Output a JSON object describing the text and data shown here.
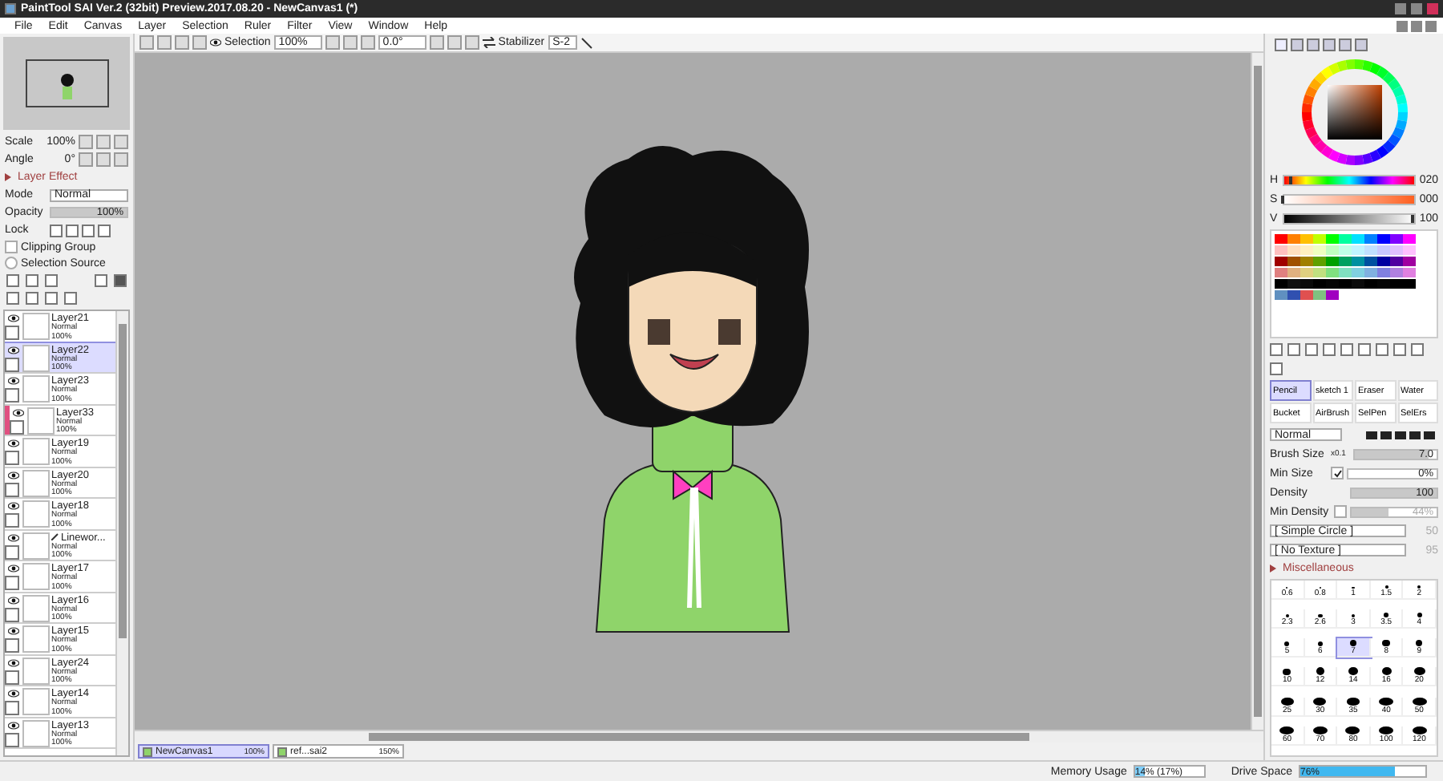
{
  "window": {
    "title": "PaintTool SAI Ver.2 (32bit) Preview.2017.08.20 - NewCanvas1 (*)"
  },
  "menu": [
    "File",
    "Edit",
    "Canvas",
    "Layer",
    "Selection",
    "Ruler",
    "Filter",
    "View",
    "Window",
    "Help"
  ],
  "toolbar": {
    "selection_label": "Selection",
    "zoom": "100%",
    "angle": "0.0°",
    "stabilizer_label": "Stabilizer",
    "stabilizer": "S-2"
  },
  "navigator": {
    "scale_label": "Scale",
    "scale": "100%",
    "angle_label": "Angle",
    "angle": "0°"
  },
  "layer_effect": {
    "title": "Layer Effect",
    "mode_label": "Mode",
    "mode": "Normal",
    "opacity_label": "Opacity",
    "opacity": "100%",
    "level": 1,
    "lock_label": "Lock"
  },
  "layer_options": [
    {
      "kind": "checkbox",
      "label": "Clipping Group",
      "checked": false
    },
    {
      "kind": "radio",
      "label": "Selection Source",
      "checked": false
    }
  ],
  "layers": [
    {
      "name": "Layer21",
      "mode": "Normal",
      "opacity": "100%",
      "selected": false,
      "clipping": false,
      "kind": "plain"
    },
    {
      "name": "Layer22",
      "mode": "Normal",
      "opacity": "100%",
      "selected": true,
      "clipping": false,
      "kind": "plain"
    },
    {
      "name": "Layer23",
      "mode": "Normal",
      "opacity": "100%",
      "selected": false,
      "clipping": false,
      "kind": "plain"
    },
    {
      "name": "Layer33",
      "mode": "Normal",
      "opacity": "100%",
      "selected": false,
      "clipping": true,
      "kind": "plain"
    },
    {
      "name": "Layer19",
      "mode": "Normal",
      "opacity": "100%",
      "selected": false,
      "clipping": false,
      "kind": "plain"
    },
    {
      "name": "Layer20",
      "mode": "Normal",
      "opacity": "100%",
      "selected": false,
      "clipping": false,
      "kind": "plain"
    },
    {
      "name": "Layer18",
      "mode": "Normal",
      "opacity": "100%",
      "selected": false,
      "clipping": false,
      "kind": "plain"
    },
    {
      "name": "Linewor...",
      "mode": "Normal",
      "opacity": "100%",
      "selected": false,
      "clipping": false,
      "kind": "linework"
    },
    {
      "name": "Layer17",
      "mode": "Normal",
      "opacity": "100%",
      "selected": false,
      "clipping": false,
      "kind": "plain"
    },
    {
      "name": "Layer16",
      "mode": "Normal",
      "opacity": "100%",
      "selected": false,
      "clipping": false,
      "kind": "plain"
    },
    {
      "name": "Layer15",
      "mode": "Normal",
      "opacity": "100%",
      "selected": false,
      "clipping": false,
      "kind": "plain"
    },
    {
      "name": "Layer24",
      "mode": "Normal",
      "opacity": "100%",
      "selected": false,
      "clipping": false,
      "kind": "plain"
    },
    {
      "name": "Layer14",
      "mode": "Normal",
      "opacity": "100%",
      "selected": false,
      "clipping": false,
      "kind": "plain"
    },
    {
      "name": "Layer13",
      "mode": "Normal",
      "opacity": "100%",
      "selected": false,
      "clipping": false,
      "kind": "plain"
    }
  ],
  "canvas_tabs": [
    {
      "name": "NewCanvas1",
      "zoom": "100%",
      "selected": true
    },
    {
      "name": "ref...sai2",
      "zoom": "150%",
      "selected": false
    }
  ],
  "hsv": [
    {
      "label": "H",
      "value": "020",
      "level": 0.06
    },
    {
      "label": "S",
      "value": "000",
      "level": 0
    },
    {
      "label": "V",
      "value": "100",
      "level": 1
    }
  ],
  "swatch_rows": [
    [
      {
        "color": "#ff0000"
      },
      {
        "color": "#ff8000"
      },
      {
        "color": "#ffc000"
      },
      {
        "color": "#c0ff00"
      },
      {
        "color": "#00ff00"
      },
      {
        "color": "#00ffa0"
      },
      {
        "color": "#00e0ff"
      },
      {
        "color": "#0080ff"
      },
      {
        "color": "#0000ff"
      },
      {
        "color": "#8000ff"
      },
      {
        "color": "#ff00ff"
      }
    ],
    [
      {
        "color": "#ffc0c0"
      },
      {
        "color": "#ffe0c0"
      },
      {
        "color": "#fff0c0"
      },
      {
        "color": "#f0ffc0"
      },
      {
        "color": "#c0ffc0"
      },
      {
        "color": "#c0ffe8"
      },
      {
        "color": "#c0f4ff"
      },
      {
        "color": "#c0e0ff"
      },
      {
        "color": "#c8c8ff"
      },
      {
        "color": "#e0c0ff"
      },
      {
        "color": "#ffc0ff"
      }
    ],
    [
      {
        "color": "#a00000"
      },
      {
        "color": "#a05000"
      },
      {
        "color": "#a08000"
      },
      {
        "color": "#60a000"
      },
      {
        "color": "#00a000"
      },
      {
        "color": "#00a060"
      },
      {
        "color": "#0090a0"
      },
      {
        "color": "#0050a0"
      },
      {
        "color": "#0000a0"
      },
      {
        "color": "#5000a0"
      },
      {
        "color": "#a000a0"
      }
    ],
    [
      {
        "color": "#e08080"
      },
      {
        "color": "#e0b080"
      },
      {
        "color": "#e0d080"
      },
      {
        "color": "#c0e080"
      },
      {
        "color": "#80e080"
      },
      {
        "color": "#80e0c0"
      },
      {
        "color": "#80d0e0"
      },
      {
        "color": "#80b0e0"
      },
      {
        "color": "#8080e0"
      },
      {
        "color": "#b080e0"
      },
      {
        "color": "#e080e0"
      }
    ],
    [
      {
        "color": "#000000"
      },
      {
        "color": "#101010"
      },
      {
        "color": "#0a0a0a"
      },
      {
        "color": "#000000"
      },
      {
        "color": "#050505"
      },
      {
        "color": "#000000"
      },
      {
        "color": "#0a0a0a"
      },
      {
        "color": "#000000"
      },
      {
        "color": "#050505"
      },
      {
        "color": "#000000"
      },
      {
        "color": "#000000"
      }
    ],
    [
      {
        "color": "#6090c0"
      },
      {
        "color": "#3050b0"
      },
      {
        "color": "#e05050"
      },
      {
        "color": "#80c080"
      },
      {
        "color": "#a000c0"
      }
    ]
  ],
  "brush_tools": [
    {
      "label": "Pencil",
      "selected": true
    },
    {
      "label": "sketch 1",
      "selected": false
    },
    {
      "label": "Eraser",
      "selected": false
    },
    {
      "label": "Water",
      "selected": false
    },
    {
      "label": "Bucket",
      "selected": false
    },
    {
      "label": "AirBrush",
      "selected": false
    },
    {
      "label": "SelPen",
      "selected": false
    },
    {
      "label": "SelErs",
      "selected": false
    }
  ],
  "brush": {
    "blend": "Normal",
    "size": {
      "label": "Brush Size",
      "multiplier": "x0.1",
      "value": "7.0",
      "level": 0.9
    },
    "min_size": {
      "label": "Min Size",
      "checked": true,
      "value": "0%"
    },
    "density": {
      "label": "Density",
      "value": "100",
      "level": 1
    },
    "min_density": {
      "label": "Min Density",
      "checked": false,
      "value": "44%",
      "level": 0.44
    },
    "shape": "[ Simple Circle ]",
    "shape_value": "50",
    "texture": "[ No Texture ]",
    "texture_value": "95",
    "misc_label": "Miscellaneous"
  },
  "brush_sizes": [
    {
      "label": "0.6",
      "selected": false
    },
    {
      "label": "0.8",
      "selected": false
    },
    {
      "label": "1",
      "selected": false
    },
    {
      "label": "1.5",
      "selected": false
    },
    {
      "label": "2",
      "selected": false
    },
    {
      "label": "2.3",
      "selected": false
    },
    {
      "label": "2.6",
      "selected": false
    },
    {
      "label": "3",
      "selected": false
    },
    {
      "label": "3.5",
      "selected": false
    },
    {
      "label": "4",
      "selected": false
    },
    {
      "label": "5",
      "selected": false
    },
    {
      "label": "6",
      "selected": false
    },
    {
      "label": "7",
      "selected": true
    },
    {
      "label": "8",
      "selected": false
    },
    {
      "label": "9",
      "selected": false
    },
    {
      "label": "10",
      "selected": false
    },
    {
      "label": "12",
      "selected": false
    },
    {
      "label": "14",
      "selected": false
    },
    {
      "label": "16",
      "selected": false
    },
    {
      "label": "20",
      "selected": false
    },
    {
      "label": "25",
      "selected": false
    },
    {
      "label": "30",
      "selected": false
    },
    {
      "label": "35",
      "selected": false
    },
    {
      "label": "40",
      "selected": false
    },
    {
      "label": "50",
      "selected": false
    },
    {
      "label": "60",
      "selected": false
    },
    {
      "label": "70",
      "selected": false
    },
    {
      "label": "80",
      "selected": false
    },
    {
      "label": "100",
      "selected": false
    },
    {
      "label": "120",
      "selected": false
    }
  ],
  "status": {
    "memory": {
      "label": "Memory Usage",
      "value": "14% (17%)",
      "level": 0.14
    },
    "drive": {
      "label": "Drive Space",
      "value": "76%",
      "level": 0.76
    }
  }
}
